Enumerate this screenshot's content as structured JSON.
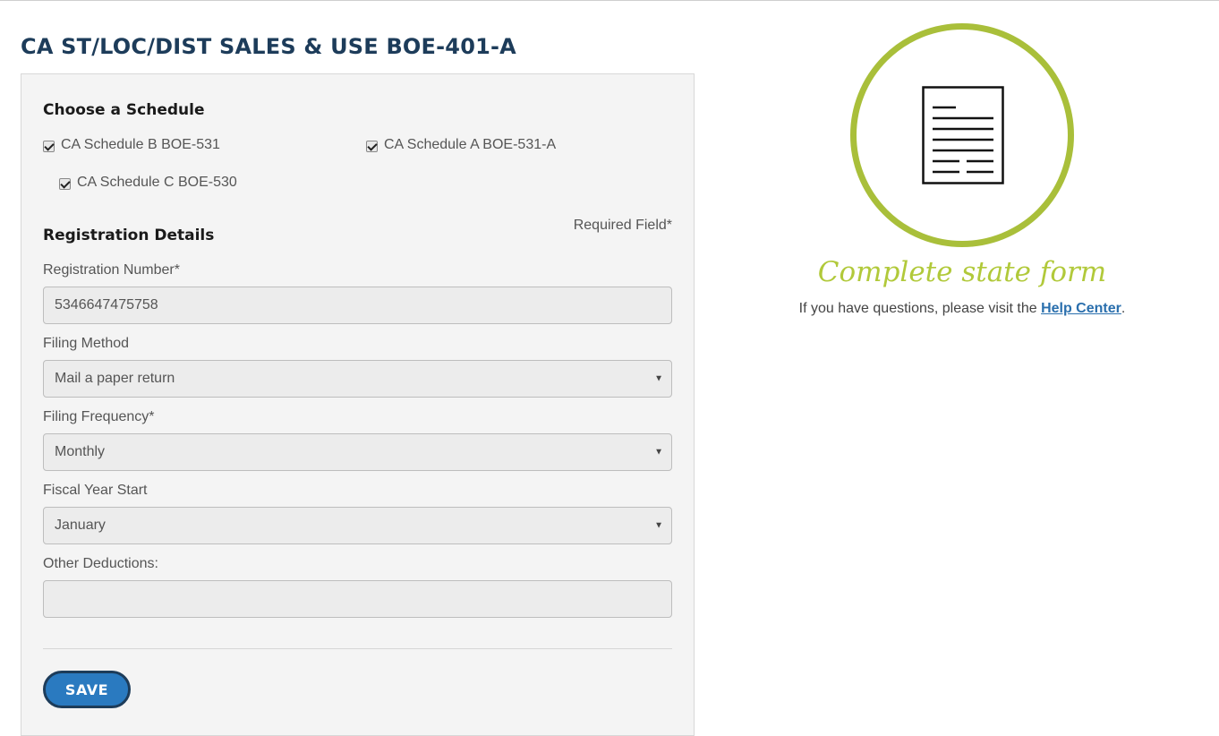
{
  "page": {
    "title": "CA ST/LOC/DIST SALES & USE BOE-401-A"
  },
  "schedule": {
    "heading": "Choose a Schedule",
    "items": [
      {
        "label": "CA Schedule B BOE-531",
        "checked": true
      },
      {
        "label": "CA Schedule A BOE-531-A",
        "checked": true
      },
      {
        "label": "CA Schedule C BOE-530",
        "checked": true
      }
    ]
  },
  "registration": {
    "heading": "Registration Details",
    "required_note": "Required Field*",
    "number_label": "Registration Number*",
    "number_value": "5346647475758",
    "filing_method_label": "Filing Method",
    "filing_method_value": "Mail a paper return",
    "filing_frequency_label": "Filing Frequency*",
    "filing_frequency_value": "Monthly",
    "fiscal_year_label": "Fiscal Year Start",
    "fiscal_year_value": "January",
    "other_deductions_label": "Other Deductions:",
    "other_deductions_value": ""
  },
  "actions": {
    "save_label": "SAVE"
  },
  "sidebar": {
    "icon": "document-icon",
    "title": "Complete state form",
    "help_prefix": "If you have questions, please visit the ",
    "help_link": "Help Center",
    "help_suffix": "."
  },
  "colors": {
    "title": "#1d3c5a",
    "accent_green": "#a9bf3a",
    "button": "#2a7ac0",
    "link": "#2a6fad"
  }
}
